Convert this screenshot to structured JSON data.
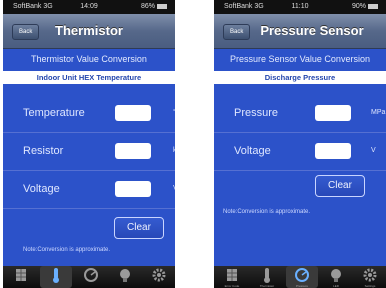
{
  "left_screen": {
    "status": {
      "carrier": "SoftBank 3G",
      "time": "14:09",
      "battery": "86%"
    },
    "back_label": "Back",
    "title": "Thermistor",
    "subtitle": "Thermistor Value Conversion",
    "section_header": "Indoor Unit HEX Temperature",
    "fields": [
      {
        "label": "Temperature",
        "value": "",
        "unit": "°C"
      },
      {
        "label": "Resistor",
        "value": "",
        "unit": "kΩ"
      },
      {
        "label": "Voltage",
        "value": "",
        "unit": "V"
      }
    ],
    "clear_label": "Clear",
    "note": "Note:Conversion is approximate."
  },
  "right_screen": {
    "status": {
      "carrier": "SoftBank 3G",
      "time": "11:10",
      "battery": "90%"
    },
    "back_label": "Back",
    "title": "Pressure Sensor",
    "subtitle": "Pressure Sensor Value Conversion",
    "section_header": "Discharge Pressure",
    "fields": [
      {
        "label": "Pressure",
        "value": "",
        "unit": "MPa"
      },
      {
        "label": "Voltage",
        "value": "",
        "unit": "V"
      }
    ],
    "clear_label": "Clear",
    "note": "Note:Conversion is approximate.",
    "tabs_labels": [
      "Error Code",
      "Thermistor",
      "Pressure",
      "LED",
      "Settings"
    ]
  },
  "tab_icons": [
    "grid-icon",
    "thermometer-icon",
    "gauge-icon",
    "bulb-icon",
    "gear-icon"
  ],
  "colors": {
    "screen_bg": "#2c52c9",
    "navbar": "#56688a",
    "header_band_text": "#2346ad"
  }
}
